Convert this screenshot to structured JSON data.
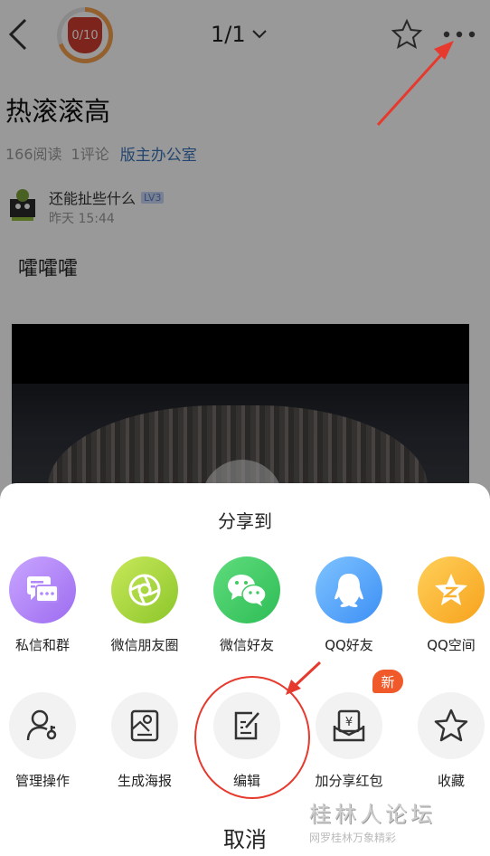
{
  "topbar": {
    "badge_text": "0/10",
    "pager": "1/1"
  },
  "post": {
    "title": "热滚滚高",
    "reads": "166阅读",
    "comments": "1评论",
    "forum": "版主办公室",
    "author_name": "还能扯些什么",
    "author_level": "LV3",
    "author_time": "昨天 15:44",
    "body": "嚯嚯嚯"
  },
  "share_sheet": {
    "title": "分享到",
    "row1": [
      {
        "label": "私信和群",
        "icon": "message-group-icon",
        "color": "#a97cf5"
      },
      {
        "label": "微信朋友圈",
        "icon": "moments-icon",
        "color": "#9ed23c"
      },
      {
        "label": "微信好友",
        "icon": "wechat-icon",
        "color": "#3fca63"
      },
      {
        "label": "QQ好友",
        "icon": "qq-icon",
        "color": "#4f9bf7"
      },
      {
        "label": "QQ空间",
        "icon": "qzone-icon",
        "color": "#f9b12f"
      }
    ],
    "row2": [
      {
        "label": "管理操作",
        "icon": "manage-user-icon"
      },
      {
        "label": "生成海报",
        "icon": "poster-icon"
      },
      {
        "label": "编辑",
        "icon": "edit-icon"
      },
      {
        "label": "加分享红包",
        "icon": "red-packet-icon"
      },
      {
        "label": "收藏",
        "icon": "star-icon"
      }
    ],
    "new_badge": "新",
    "cancel": "取消"
  },
  "watermark": {
    "line1": "桂林人论坛",
    "line2": "网罗桂林万象精彩"
  },
  "colors": {
    "annotation_red": "#e63a2e",
    "forum_link": "#3b73b9"
  }
}
